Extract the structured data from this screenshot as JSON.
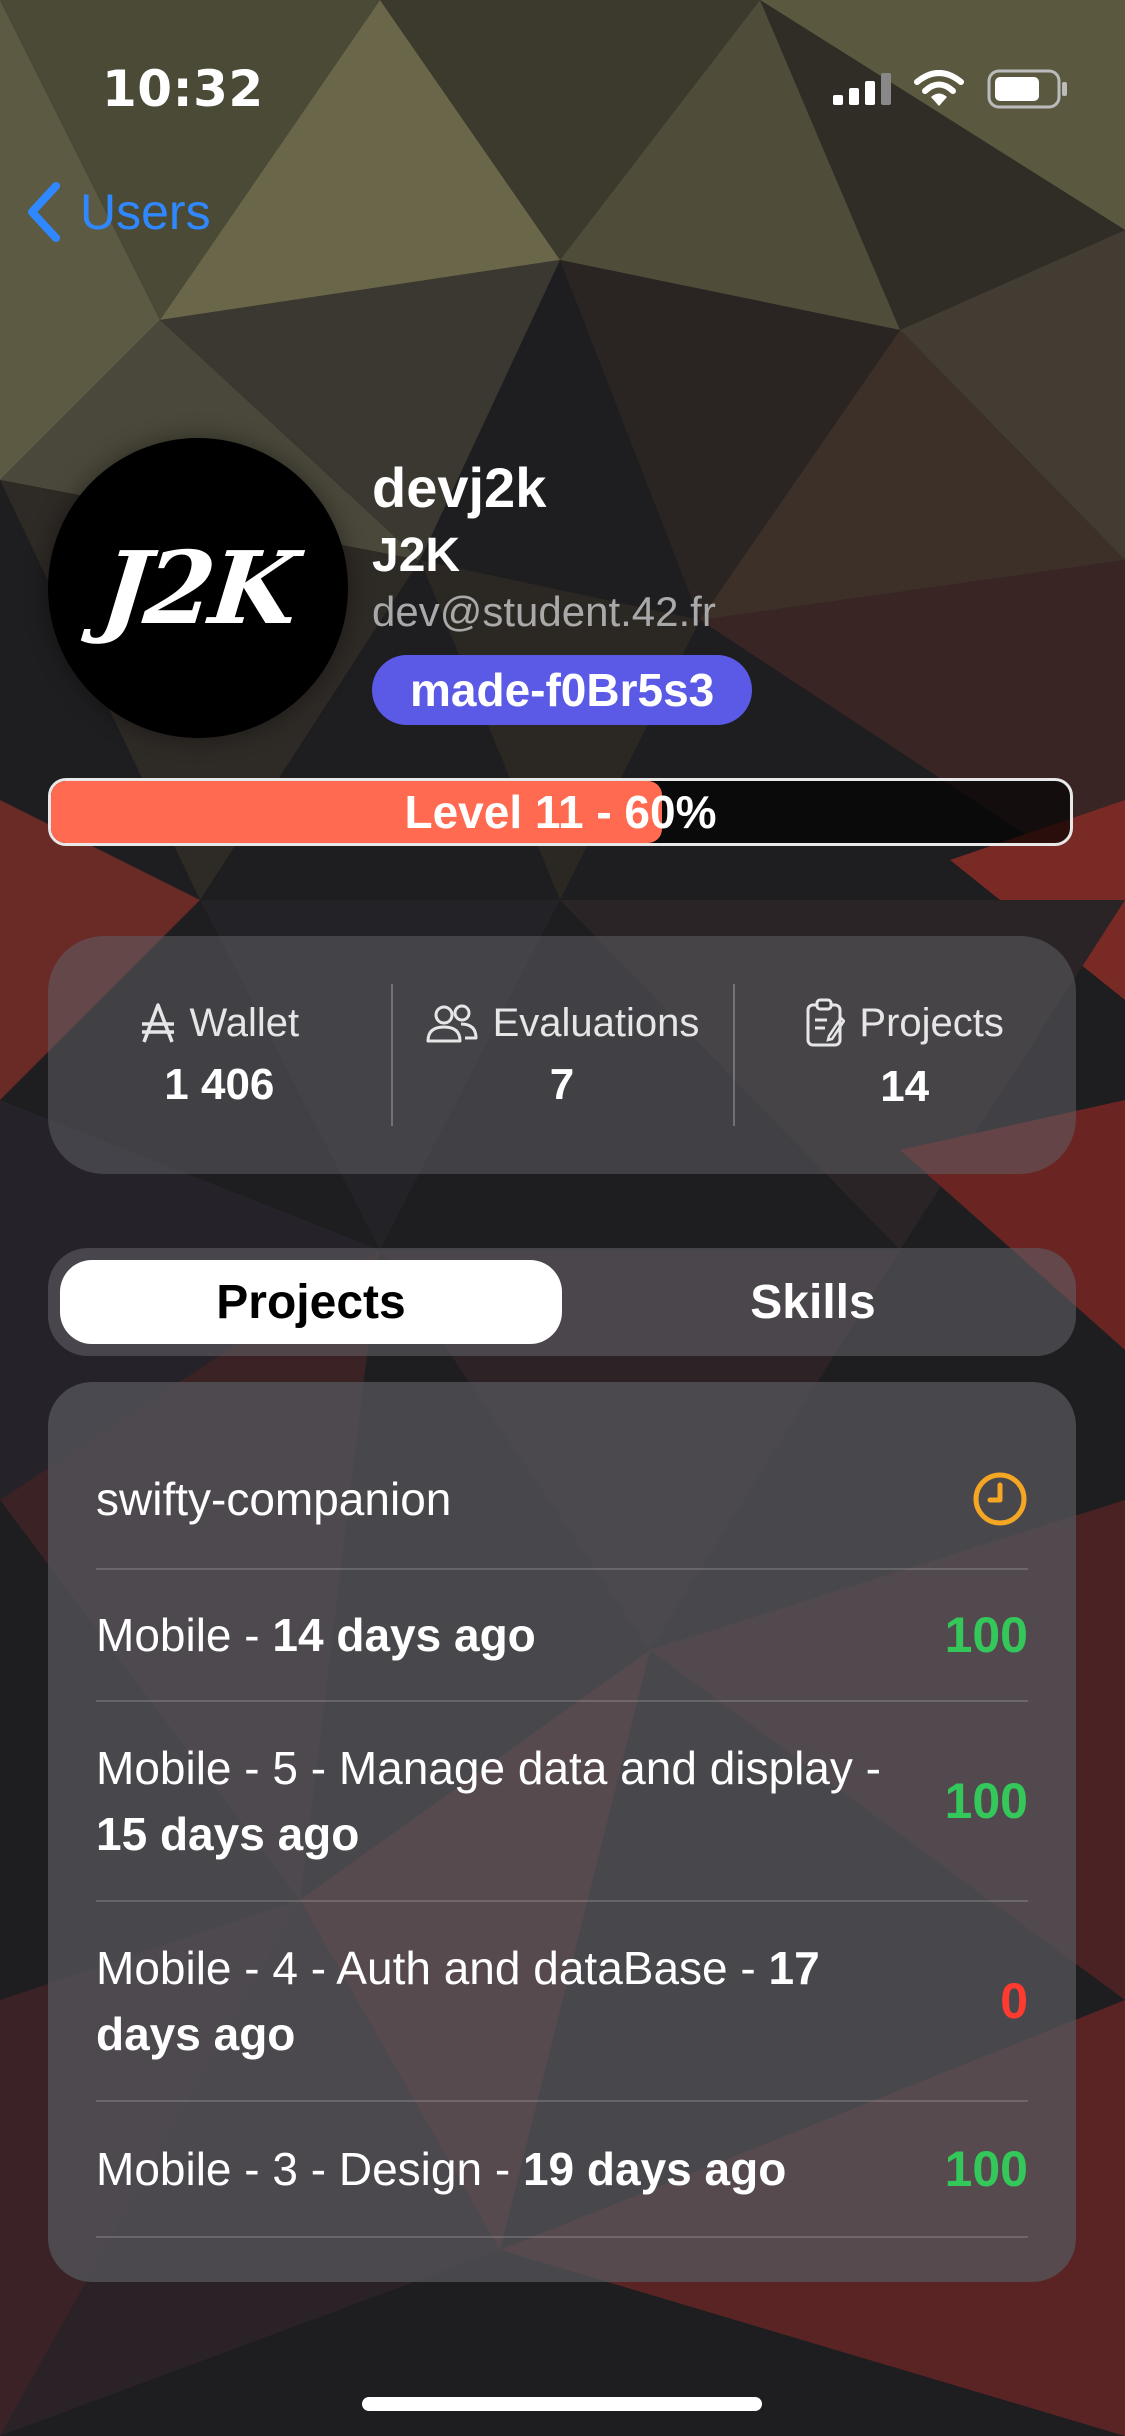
{
  "status_bar": {
    "time": "10:32",
    "icons": [
      "signal-icon",
      "wifi-icon",
      "battery-icon"
    ]
  },
  "nav": {
    "back_label": "Users",
    "back_icon": "chevron-left-icon"
  },
  "profile": {
    "avatar_text": "J2K",
    "login": "devj2k",
    "display_name": "J2K",
    "email": "dev@student.42.fr",
    "badge": "made-f0Br5s3",
    "badge_color": "#5a5ae6"
  },
  "level": {
    "label": "Level 11 - 60%",
    "progress": 0.6,
    "fill_color": "#ff6a50"
  },
  "stats": [
    {
      "icon": "currency-icon",
      "label": "Wallet",
      "value": "1 406"
    },
    {
      "icon": "people-icon",
      "label": "Evaluations",
      "value": "7"
    },
    {
      "icon": "clipboard-icon",
      "label": "Projects",
      "value": "14"
    }
  ],
  "tabs": {
    "selected": "Projects",
    "items": [
      "Projects",
      "Skills"
    ]
  },
  "projects": [
    {
      "name": "swifty-companion",
      "when": "",
      "status": "in-progress",
      "status_icon": "clock-icon",
      "mark": ""
    },
    {
      "name": "Mobile",
      "when": "14 days ago",
      "status": "validated",
      "mark": "100"
    },
    {
      "name": "Mobile - 5 - Manage data and display",
      "when": "15 days ago",
      "status": "validated",
      "mark": "100"
    },
    {
      "name": "Mobile - 4 - Auth and dataBase",
      "when": "17 days ago",
      "status": "failed",
      "mark": "0"
    },
    {
      "name": "Mobile - 3 - Design",
      "when": "19 days ago",
      "status": "validated",
      "mark": "100"
    }
  ],
  "colors": {
    "accent_blue": "#2f88ff",
    "success": "#34c759",
    "failure": "#ff3b30",
    "pending": "#f5a623"
  }
}
